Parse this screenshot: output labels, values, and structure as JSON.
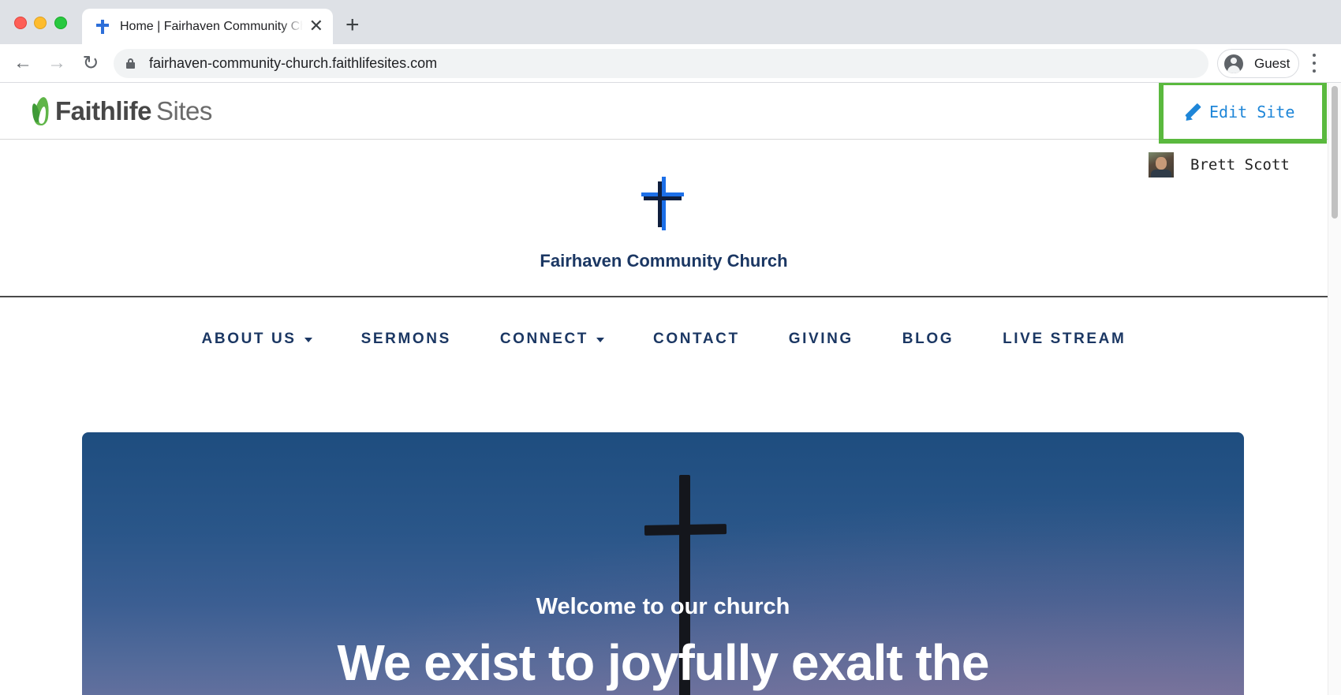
{
  "browser": {
    "tab": {
      "title": "Home | Fairhaven Community Church",
      "favicon": "cross-icon",
      "close_icon": "close-icon"
    },
    "new_tab_icon": "plus-icon",
    "toolbar": {
      "back_icon": "arrow-left-icon",
      "forward_icon": "arrow-right-icon",
      "reload_icon": "reload-icon",
      "lock_icon": "lock-icon",
      "url": "fairhaven-community-church.faithlifesites.com",
      "profile_label": "Guest",
      "menu_icon": "kebab-menu-icon"
    }
  },
  "faithlife_bar": {
    "brand_bold": "Faithlife",
    "brand_light": "Sites",
    "edit_label": "Edit Site",
    "edit_highlight_color": "#5ab93e",
    "accent_color": "#1e86d8"
  },
  "site": {
    "user_name": "Brett Scott",
    "church_name": "Fairhaven Community Church",
    "brand_color": "#1b3763",
    "nav": [
      {
        "label": "ABOUT US",
        "dropdown": true
      },
      {
        "label": "SERMONS",
        "dropdown": false
      },
      {
        "label": "CONNECT",
        "dropdown": true
      },
      {
        "label": "CONTACT",
        "dropdown": false
      },
      {
        "label": "GIVING",
        "dropdown": false
      },
      {
        "label": "BLOG",
        "dropdown": false
      },
      {
        "label": "LIVE STREAM",
        "dropdown": false
      }
    ],
    "hero": {
      "kicker": "Welcome to our church",
      "headline": "We exist to joyfully exalt the"
    }
  }
}
